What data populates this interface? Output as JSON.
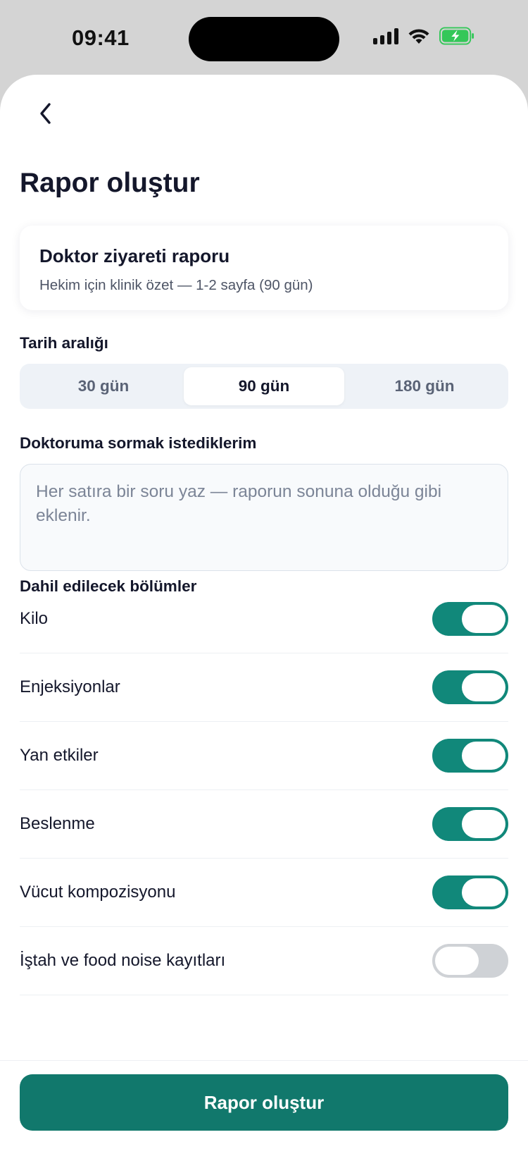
{
  "status_bar": {
    "time": "09:41",
    "icons": [
      "cellular-signal-icon",
      "wifi-icon",
      "battery-charging-icon"
    ],
    "battery_color": "#34c759"
  },
  "header": {
    "back_icon": "chevron-left-icon",
    "title": "Rapor oluştur"
  },
  "report_card": {
    "title": "Doktor ziyareti raporu",
    "subtitle": "Hekim için klinik özet — 1-2 sayfa (90 gün)"
  },
  "date_range": {
    "label": "Tarih aralığı",
    "options": [
      "30 gün",
      "90 gün",
      "180 gün"
    ],
    "selected": "90 gün"
  },
  "questions": {
    "label": "Doktoruma sormak istediklerim",
    "placeholder": "Her satıra bir soru yaz — raporun sonuna olduğu gibi eklenir.",
    "value": ""
  },
  "sections": {
    "label": "Dahil edilecek bölümler",
    "items": [
      {
        "label": "Kilo",
        "enabled": true
      },
      {
        "label": "Enjeksiyonlar",
        "enabled": true
      },
      {
        "label": "Yan etkiler",
        "enabled": true
      },
      {
        "label": "Beslenme",
        "enabled": true
      },
      {
        "label": "Vücut kompozisyonu",
        "enabled": true
      },
      {
        "label": "İştah ve food noise kayıtları",
        "enabled": false
      }
    ]
  },
  "footer": {
    "submit_label": "Rapor oluştur"
  },
  "colors": {
    "accent": "#11887a",
    "button": "#11786c",
    "toggle_off": "#cfd2d6"
  }
}
